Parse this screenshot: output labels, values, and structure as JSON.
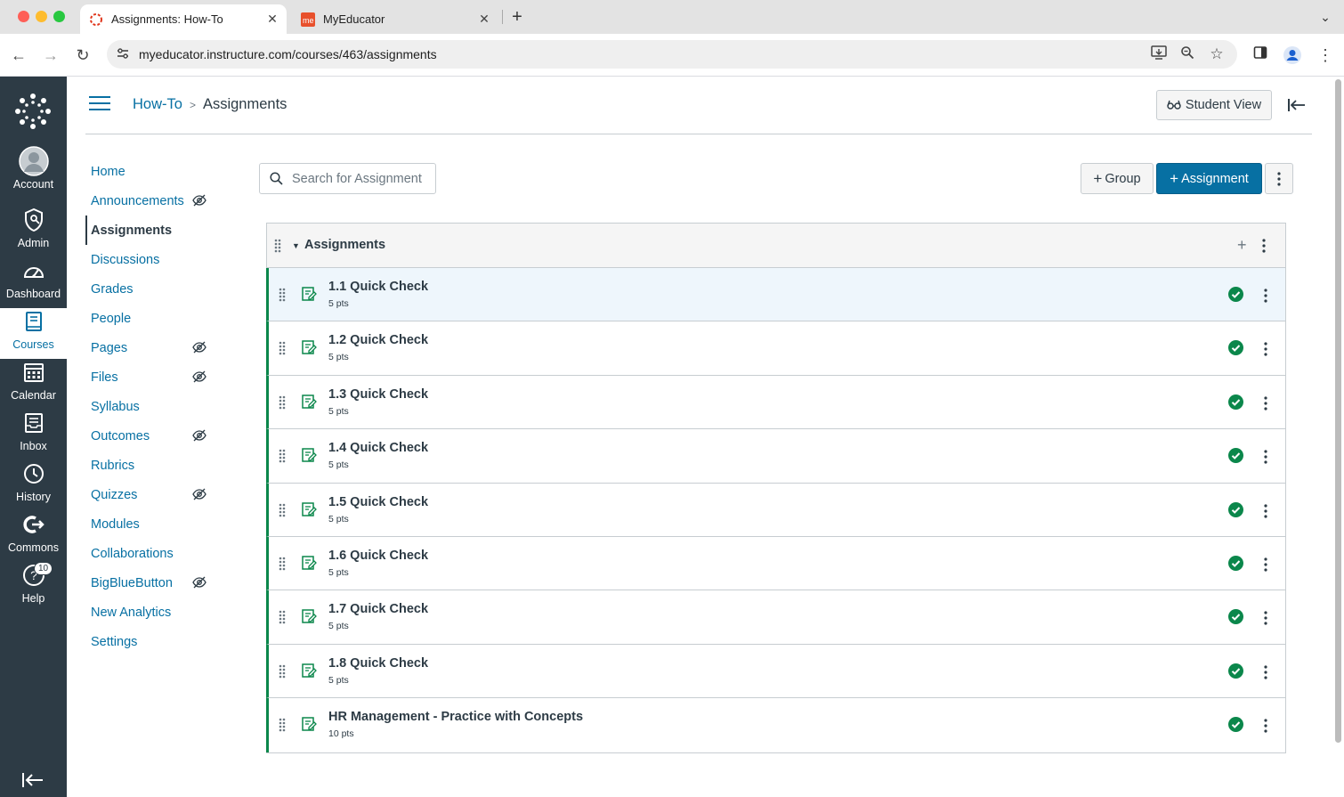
{
  "browser": {
    "tabs": [
      {
        "title": "Assignments: How-To",
        "active": true
      },
      {
        "title": "MyEducator",
        "active": false
      }
    ],
    "url": "myeducator.instructure.com/courses/463/assignments"
  },
  "global_nav": {
    "items": [
      {
        "label": "Account",
        "icon": "account-icon"
      },
      {
        "label": "Admin",
        "icon": "admin-icon"
      },
      {
        "label": "Dashboard",
        "icon": "dashboard-icon"
      },
      {
        "label": "Courses",
        "icon": "courses-icon",
        "active": true
      },
      {
        "label": "Calendar",
        "icon": "calendar-icon"
      },
      {
        "label": "Inbox",
        "icon": "inbox-icon"
      },
      {
        "label": "History",
        "icon": "history-icon"
      },
      {
        "label": "Commons",
        "icon": "commons-icon"
      },
      {
        "label": "Help",
        "icon": "help-icon",
        "badge": "10"
      }
    ]
  },
  "header": {
    "breadcrumb_course": "How-To",
    "breadcrumb_page": "Assignments",
    "student_view": "Student View"
  },
  "course_nav": [
    {
      "label": "Home",
      "hidden": false
    },
    {
      "label": "Announcements",
      "hidden": true
    },
    {
      "label": "Assignments",
      "hidden": false,
      "active": true
    },
    {
      "label": "Discussions",
      "hidden": false
    },
    {
      "label": "Grades",
      "hidden": false
    },
    {
      "label": "People",
      "hidden": false
    },
    {
      "label": "Pages",
      "hidden": true
    },
    {
      "label": "Files",
      "hidden": true
    },
    {
      "label": "Syllabus",
      "hidden": false
    },
    {
      "label": "Outcomes",
      "hidden": true
    },
    {
      "label": "Rubrics",
      "hidden": false
    },
    {
      "label": "Quizzes",
      "hidden": true
    },
    {
      "label": "Modules",
      "hidden": false
    },
    {
      "label": "Collaborations",
      "hidden": false
    },
    {
      "label": "BigBlueButton",
      "hidden": true
    },
    {
      "label": "New Analytics",
      "hidden": false
    },
    {
      "label": "Settings",
      "hidden": false
    }
  ],
  "toolbar": {
    "search_placeholder": "Search for Assignment",
    "group_label": "Group",
    "assignment_label": "Assignment"
  },
  "assignment_group": {
    "title": "Assignments",
    "items": [
      {
        "title": "1.1 Quick Check",
        "points": "5 pts",
        "published": true
      },
      {
        "title": "1.2 Quick Check",
        "points": "5 pts",
        "published": true
      },
      {
        "title": "1.3 Quick Check",
        "points": "5 pts",
        "published": true
      },
      {
        "title": "1.4 Quick Check",
        "points": "5 pts",
        "published": true
      },
      {
        "title": "1.5 Quick Check",
        "points": "5 pts",
        "published": true
      },
      {
        "title": "1.6 Quick Check",
        "points": "5 pts",
        "published": true
      },
      {
        "title": "1.7 Quick Check",
        "points": "5 pts",
        "published": true
      },
      {
        "title": "1.8 Quick Check",
        "points": "5 pts",
        "published": true
      },
      {
        "title": "HR Management - Practice with Concepts",
        "points": "10 pts",
        "published": true
      }
    ]
  },
  "colors": {
    "nav_bg": "#2d3b45",
    "link": "#0770a3",
    "primary_button": "#0770a3",
    "published_green": "#0b874b"
  }
}
